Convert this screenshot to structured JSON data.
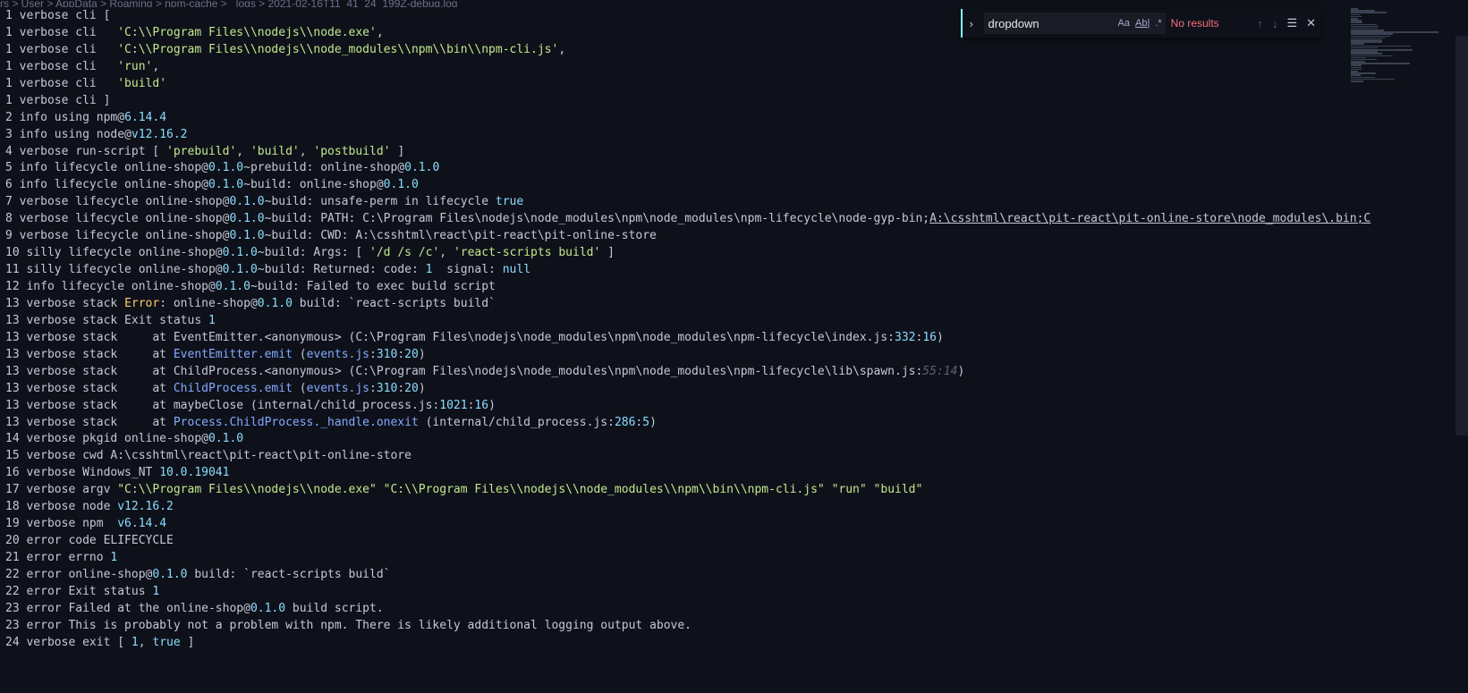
{
  "breadcrumb": "rs > User > AppData > Roaming > npm-cache > _logs > 2021-02-16T11_41_24_199Z-debug.log",
  "find": {
    "value": "dropdown",
    "match_case_icon": "Aa",
    "whole_word_icon": "Ab|",
    "regex_icon": ".*",
    "status": "No results"
  },
  "lines": [
    [
      [
        "1 verbose cli [",
        ""
      ]
    ],
    [
      [
        "1 verbose cli   ",
        ""
      ],
      [
        "'C:\\\\Program Files\\\\nodejs\\\\node.exe'",
        "str"
      ],
      [
        ",",
        ""
      ]
    ],
    [
      [
        "1 verbose cli   ",
        ""
      ],
      [
        "'C:\\\\Program Files\\\\nodejs\\\\node_modules\\\\npm\\\\bin\\\\npm-cli.js'",
        "str"
      ],
      [
        ",",
        ""
      ]
    ],
    [
      [
        "1 verbose cli   ",
        ""
      ],
      [
        "'run'",
        "str"
      ],
      [
        ",",
        ""
      ]
    ],
    [
      [
        "1 verbose cli   ",
        ""
      ],
      [
        "'build'",
        "str"
      ]
    ],
    [
      [
        "1 verbose cli ]",
        ""
      ]
    ],
    [
      [
        "2 info using npm@",
        ""
      ],
      [
        "6.14.4",
        "num"
      ]
    ],
    [
      [
        "3 info using node@",
        ""
      ],
      [
        "v12.16.2",
        "num"
      ]
    ],
    [
      [
        "4 verbose run-script [ ",
        ""
      ],
      [
        "'prebuild'",
        "str"
      ],
      [
        ", ",
        ""
      ],
      [
        "'build'",
        "str"
      ],
      [
        ", ",
        ""
      ],
      [
        "'postbuild'",
        "str"
      ],
      [
        " ]",
        ""
      ]
    ],
    [
      [
        "5 info lifecycle online-shop@",
        ""
      ],
      [
        "0.1.0",
        "num"
      ],
      [
        "~prebuild: online-shop@",
        ""
      ],
      [
        "0.1.0",
        "num"
      ]
    ],
    [
      [
        "6 info lifecycle online-shop@",
        ""
      ],
      [
        "0.1.0",
        "num"
      ],
      [
        "~build: online-shop@",
        ""
      ],
      [
        "0.1.0",
        "num"
      ]
    ],
    [
      [
        "7 verbose lifecycle online-shop@",
        ""
      ],
      [
        "0.1.0",
        "num"
      ],
      [
        "~build: unsafe-perm in lifecycle ",
        ""
      ],
      [
        "true",
        "kw"
      ]
    ],
    [
      [
        "8 verbose lifecycle online-shop@",
        ""
      ],
      [
        "0.1.0",
        "num"
      ],
      [
        "~build: PATH: C:\\Program Files\\nodejs\\node_modules\\npm\\node_modules\\npm-lifecycle\\node-gyp-bin;",
        ""
      ],
      [
        "A:\\csshtml\\react\\pit-react\\pit-online-store\\node_modules\\.bin;C",
        "link"
      ]
    ],
    [
      [
        "9 verbose lifecycle online-shop@",
        ""
      ],
      [
        "0.1.0",
        "num"
      ],
      [
        "~build: CWD: A:\\csshtml\\react\\pit-react\\pit-online-store",
        ""
      ]
    ],
    [
      [
        "10 silly lifecycle online-shop@",
        ""
      ],
      [
        "0.1.0",
        "num"
      ],
      [
        "~build: Args: [ ",
        ""
      ],
      [
        "'/d /s /c'",
        "str"
      ],
      [
        ", ",
        ""
      ],
      [
        "'react-scripts build'",
        "str"
      ],
      [
        " ]",
        ""
      ]
    ],
    [
      [
        "11 silly lifecycle online-shop@",
        ""
      ],
      [
        "0.1.0",
        "num"
      ],
      [
        "~build: Returned: code: ",
        ""
      ],
      [
        "1",
        "num"
      ],
      [
        "  signal: ",
        ""
      ],
      [
        "null",
        "kw"
      ]
    ],
    [
      [
        "12 info lifecycle online-shop@",
        ""
      ],
      [
        "0.1.0",
        "num"
      ],
      [
        "~build: Failed to exec build script",
        ""
      ]
    ],
    [
      [
        "13 verbose stack ",
        ""
      ],
      [
        "Error",
        "err"
      ],
      [
        ": online-shop@",
        ""
      ],
      [
        "0.1.0",
        "num"
      ],
      [
        " build: `react-scripts build`",
        ""
      ]
    ],
    [
      [
        "13 verbose stack Exit status ",
        ""
      ],
      [
        "1",
        "num"
      ]
    ],
    [
      [
        "13 verbose stack     at EventEmitter.<anonymous> (C:\\Program Files\\nodejs\\node_modules\\npm\\node_modules\\npm-lifecycle\\index.js:",
        ""
      ],
      [
        "332",
        "num"
      ],
      [
        ":",
        ""
      ],
      [
        "16",
        "num"
      ],
      [
        ")",
        ""
      ]
    ],
    [
      [
        "13 verbose stack     at ",
        ""
      ],
      [
        "EventEmitter.emit",
        "fn"
      ],
      [
        " (",
        ""
      ],
      [
        "events.js",
        "fn"
      ],
      [
        ":",
        ""
      ],
      [
        "310",
        "num"
      ],
      [
        ":",
        ""
      ],
      [
        "20",
        "num"
      ],
      [
        ")",
        ""
      ]
    ],
    [
      [
        "13 verbose stack     at ChildProcess.<anonymous> (C:\\Program Files\\nodejs\\node_modules\\npm\\node_modules\\npm-lifecycle\\lib\\spawn.js:",
        ""
      ],
      [
        "55:14",
        "muted"
      ],
      [
        ")",
        ""
      ]
    ],
    [
      [
        "13 verbose stack     at ",
        ""
      ],
      [
        "ChildProcess.emit",
        "fn"
      ],
      [
        " (",
        ""
      ],
      [
        "events.js",
        "fn"
      ],
      [
        ":",
        ""
      ],
      [
        "310",
        "num"
      ],
      [
        ":",
        ""
      ],
      [
        "20",
        "num"
      ],
      [
        ")",
        ""
      ]
    ],
    [
      [
        "13 verbose stack     at maybeClose (internal/child_process.js:",
        ""
      ],
      [
        "1021",
        "num"
      ],
      [
        ":",
        ""
      ],
      [
        "16",
        "num"
      ],
      [
        ")",
        ""
      ]
    ],
    [
      [
        "13 verbose stack     at ",
        ""
      ],
      [
        "Process.ChildProcess._handle.onexit",
        "fn"
      ],
      [
        " (internal/child_process.js:",
        ""
      ],
      [
        "286",
        "num"
      ],
      [
        ":",
        ""
      ],
      [
        "5",
        "num"
      ],
      [
        ")",
        ""
      ]
    ],
    [
      [
        "14 verbose pkgid online-shop@",
        ""
      ],
      [
        "0.1.0",
        "num"
      ]
    ],
    [
      [
        "15 verbose cwd A:\\csshtml\\react\\pit-react\\pit-online-store",
        ""
      ]
    ],
    [
      [
        "16 verbose Windows_NT ",
        ""
      ],
      [
        "10.0.19041",
        "num"
      ]
    ],
    [
      [
        "17 verbose argv ",
        ""
      ],
      [
        "\"C:\\\\Program Files\\\\nodejs\\\\node.exe\"",
        "str"
      ],
      [
        " ",
        ""
      ],
      [
        "\"C:\\\\Program Files\\\\nodejs\\\\node_modules\\\\npm\\\\bin\\\\npm-cli.js\"",
        "str"
      ],
      [
        " ",
        ""
      ],
      [
        "\"run\"",
        "str"
      ],
      [
        " ",
        ""
      ],
      [
        "\"build\"",
        "str"
      ]
    ],
    [
      [
        "18 verbose node ",
        ""
      ],
      [
        "v12.16.2",
        "num"
      ]
    ],
    [
      [
        "19 verbose npm  ",
        ""
      ],
      [
        "v6.14.4",
        "num"
      ]
    ],
    [
      [
        "20 error code ELIFECYCLE",
        ""
      ]
    ],
    [
      [
        "21 error errno ",
        ""
      ],
      [
        "1",
        "num"
      ]
    ],
    [
      [
        "22 error online-shop@",
        ""
      ],
      [
        "0.1.0",
        "num"
      ],
      [
        " build: `react-scripts build`",
        ""
      ]
    ],
    [
      [
        "22 error Exit status ",
        ""
      ],
      [
        "1",
        "num"
      ]
    ],
    [
      [
        "23 error Failed at the online-shop@",
        ""
      ],
      [
        "0.1.0",
        "num"
      ],
      [
        " build script.",
        ""
      ]
    ],
    [
      [
        "23 error This is probably not a problem with npm. There is likely additional logging output above.",
        ""
      ]
    ],
    [
      [
        "24 verbose exit [ ",
        ""
      ],
      [
        "1",
        "num"
      ],
      [
        ", ",
        ""
      ],
      [
        "true",
        "kw"
      ],
      [
        " ]",
        ""
      ]
    ]
  ],
  "colors": {
    "background": "#0f111a",
    "text": "#c3c9d4",
    "string": "#c3e88d",
    "number": "#89ddff",
    "accent": "#84ffff",
    "error_status": "#f07178"
  }
}
